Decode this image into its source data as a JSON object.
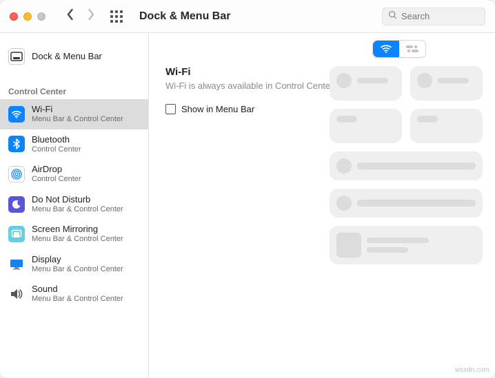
{
  "toolbar": {
    "title": "Dock & Menu Bar",
    "search_placeholder": "Search"
  },
  "sidebar": {
    "top_item": {
      "label": "Dock & Menu Bar"
    },
    "section_header": "Control Center",
    "items": [
      {
        "label": "Wi-Fi",
        "sublabel": "Menu Bar & Control Center",
        "selected": true
      },
      {
        "label": "Bluetooth",
        "sublabel": "Control Center",
        "selected": false
      },
      {
        "label": "AirDrop",
        "sublabel": "Control Center",
        "selected": false
      },
      {
        "label": "Do Not Disturb",
        "sublabel": "Menu Bar & Control Center",
        "selected": false
      },
      {
        "label": "Screen Mirroring",
        "sublabel": "Menu Bar & Control Center",
        "selected": false
      },
      {
        "label": "Display",
        "sublabel": "Menu Bar & Control Center",
        "selected": false
      },
      {
        "label": "Sound",
        "sublabel": "Menu Bar & Control Center",
        "selected": false
      }
    ]
  },
  "content": {
    "heading": "Wi-Fi",
    "description": "Wi-Fi is always available in Control Center.",
    "checkbox_label": "Show in Menu Bar",
    "checkbox_checked": false
  },
  "watermark": "wsxdn.com",
  "colors": {
    "accent_blue": "#0a84ff",
    "dnd_purple": "#5856d6",
    "mirror_teal": "#62d0de"
  }
}
